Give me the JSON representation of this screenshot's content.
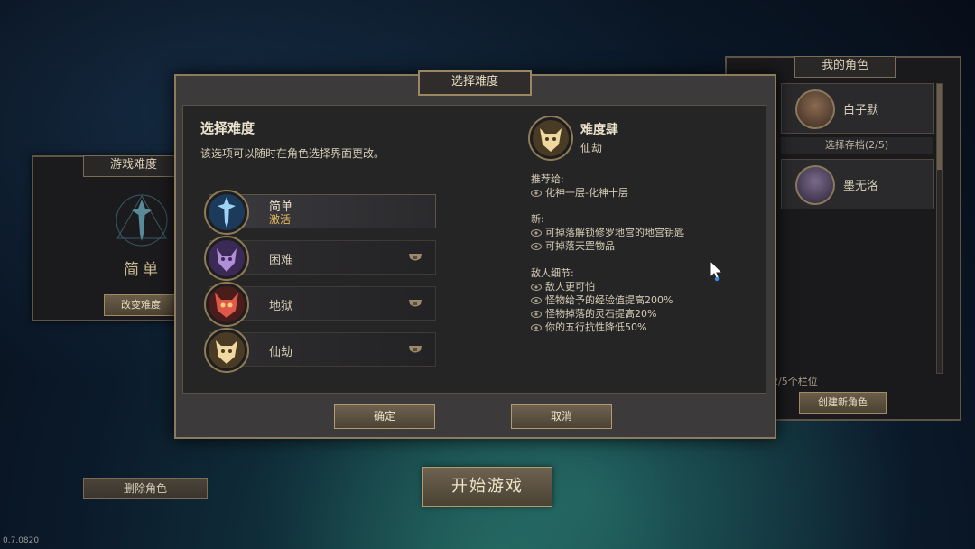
{
  "left_card": {
    "title": "游戏难度",
    "difficulty_name": "简单",
    "change_button": "改变难度"
  },
  "right_panel": {
    "title": "我的角色",
    "slot1_name": "白子默",
    "slot_label": "选择存档(2/5)",
    "slot2_name": "墨无洛",
    "slots_count": "2/5个栏位",
    "create_button": "创建新角色"
  },
  "bottom": {
    "delete_button": "删除角色",
    "start_button": "开始游戏",
    "version": "0.7.0820"
  },
  "dialog": {
    "header": "选择难度",
    "title": "选择难度",
    "description": "该选项可以随时在角色选择界面更改。",
    "options": [
      {
        "label": "简单",
        "status": "激活",
        "icon": "blue-sword-emblem-icon"
      },
      {
        "label": "困难",
        "status": "",
        "icon": "purple-demon-emblem-icon"
      },
      {
        "label": "地狱",
        "status": "",
        "icon": "red-demon-emblem-icon"
      },
      {
        "label": "仙劫",
        "status": "",
        "icon": "gold-celestial-emblem-icon"
      }
    ],
    "detail": {
      "name": "难度肆",
      "sub": "仙劫",
      "recommend_head": "推荐给:",
      "recommend_items": [
        "化神一层-化神十层"
      ],
      "new_head": "新:",
      "new_items": [
        "可掉落解锁修罗地宫的地宫钥匙",
        "可掉落天罡物品"
      ],
      "enemy_head": "敌人细节:",
      "enemy_items": [
        "敌人更可怕",
        "怪物给予的经验值提高200%",
        "怪物掉落的灵石提高20%",
        "你的五行抗性降低50%"
      ]
    },
    "confirm_button": "确定",
    "cancel_button": "取消"
  },
  "colors": {
    "accent_gold": "#e0b860",
    "frame": "#8d7b5d",
    "panel_bg": "#262526"
  }
}
